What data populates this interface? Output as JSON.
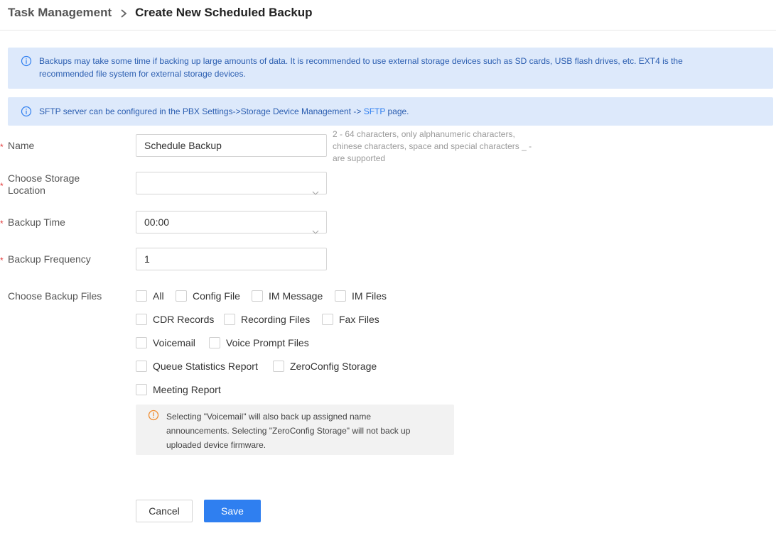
{
  "breadcrumb": {
    "parent": "Task Management",
    "current": "Create New Scheduled Backup"
  },
  "banners": {
    "backup_note": {
      "line1": "Backups may take some time if backing up large amounts of data. It is recommended to use external storage devices such as SD cards, USB flash drives, etc. EXT4 is the",
      "line2": "recommended file system for external storage devices."
    },
    "sftp_note": {
      "before": "SFTP server can be configured in the PBX Settings->Storage Device Management -> ",
      "link": "SFTP",
      "after": " page."
    }
  },
  "form": {
    "required_mark": "*",
    "name": {
      "label": "Name",
      "value": "Schedule Backup",
      "hint_line1": "2 - 64 characters, only alphanumeric characters,",
      "hint_line2": "chinese characters, space and special characters _ -",
      "hint_line3": "are supported"
    },
    "storage": {
      "label_line1": "Choose Storage",
      "label_line2": "Location",
      "value": ""
    },
    "backup_time": {
      "label": "Backup Time",
      "value": "00:00"
    },
    "backup_frequency": {
      "label": "Backup Frequency",
      "value": "1"
    },
    "backup_files": {
      "label": "Choose Backup Files",
      "options": [
        {
          "label": "All",
          "checked": false
        },
        {
          "label": "Config File",
          "checked": false
        },
        {
          "label": "IM Message",
          "checked": false
        },
        {
          "label": "IM Files",
          "checked": false
        },
        {
          "label": "CDR Records",
          "checked": false
        },
        {
          "label": "Recording Files",
          "checked": false
        },
        {
          "label": "Fax Files",
          "checked": false
        },
        {
          "label": "Voicemail",
          "checked": false
        },
        {
          "label": "Voice Prompt Files",
          "checked": false
        },
        {
          "label": "Queue Statistics Report",
          "checked": false
        },
        {
          "label": "ZeroConfig Storage",
          "checked": false
        },
        {
          "label": "Meeting Report",
          "checked": false
        }
      ]
    },
    "notice": {
      "line1": "Selecting \"Voicemail\" will also back up assigned name",
      "line2": "announcements. Selecting \"ZeroConfig Storage\" will not back up",
      "line3": "uploaded device firmware."
    }
  },
  "buttons": {
    "cancel": "Cancel",
    "save": "Save"
  },
  "colors": {
    "accent": "#2f7ff0",
    "info_banner_bg": "#dde9fb",
    "info_text": "#2a5db0",
    "required": "#e23b3b",
    "warning": "#f08c2f"
  },
  "icons": {
    "breadcrumb_separator": "chevron-right-icon",
    "banner": "info-circle-icon",
    "dropdown": "chevron-down-icon",
    "notice": "warning-circle-icon"
  }
}
